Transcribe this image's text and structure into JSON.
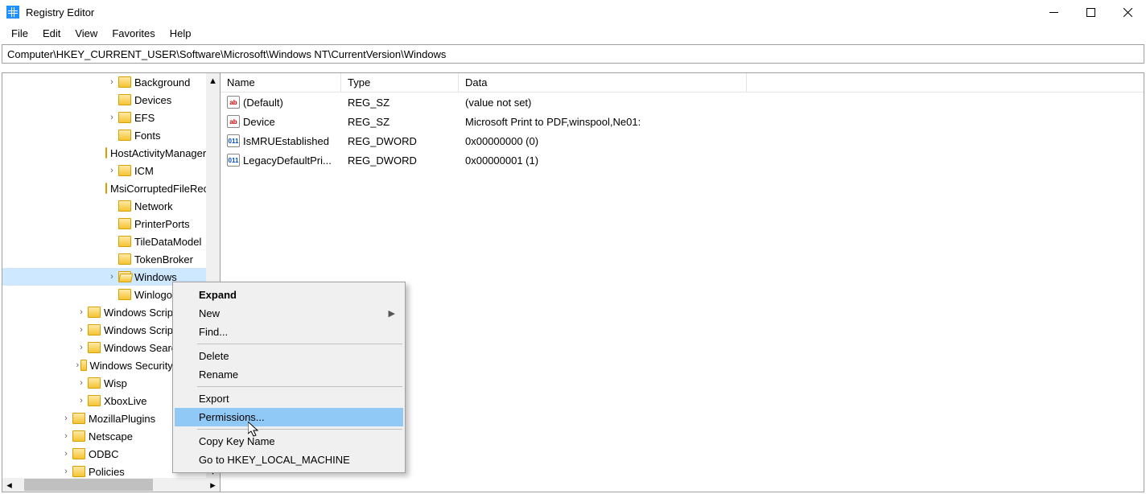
{
  "window": {
    "title": "Registry Editor"
  },
  "menubar": [
    "File",
    "Edit",
    "View",
    "Favorites",
    "Help"
  ],
  "address": "Computer\\HKEY_CURRENT_USER\\Software\\Microsoft\\Windows NT\\CurrentVersion\\Windows",
  "tree": [
    {
      "indent": 128,
      "exp": ">",
      "label": "Background",
      "selected": false
    },
    {
      "indent": 128,
      "exp": "",
      "label": "Devices"
    },
    {
      "indent": 128,
      "exp": ">",
      "label": "EFS"
    },
    {
      "indent": 128,
      "exp": "",
      "label": "Fonts"
    },
    {
      "indent": 128,
      "exp": "",
      "label": "HostActivityManager"
    },
    {
      "indent": 128,
      "exp": ">",
      "label": "ICM"
    },
    {
      "indent": 128,
      "exp": "",
      "label": "MsiCorruptedFileRecovery"
    },
    {
      "indent": 128,
      "exp": "",
      "label": "Network"
    },
    {
      "indent": 128,
      "exp": "",
      "label": "PrinterPorts"
    },
    {
      "indent": 128,
      "exp": "",
      "label": "TileDataModel"
    },
    {
      "indent": 128,
      "exp": "",
      "label": "TokenBroker"
    },
    {
      "indent": 128,
      "exp": ">",
      "label": "Windows",
      "selected": true,
      "open": true
    },
    {
      "indent": 128,
      "exp": "",
      "label": "Winlogon"
    },
    {
      "indent": 90,
      "exp": ">",
      "label": "Windows Script Host"
    },
    {
      "indent": 90,
      "exp": ">",
      "label": "Windows Script Host"
    },
    {
      "indent": 90,
      "exp": ">",
      "label": "Windows Search"
    },
    {
      "indent": 90,
      "exp": ">",
      "label": "Windows Security Health"
    },
    {
      "indent": 90,
      "exp": ">",
      "label": "Wisp"
    },
    {
      "indent": 90,
      "exp": ">",
      "label": "XboxLive"
    },
    {
      "indent": 71,
      "exp": ">",
      "label": "MozillaPlugins"
    },
    {
      "indent": 71,
      "exp": ">",
      "label": "Netscape"
    },
    {
      "indent": 71,
      "exp": ">",
      "label": "ODBC"
    },
    {
      "indent": 71,
      "exp": ">",
      "label": "Policies"
    }
  ],
  "columns": {
    "name": "Name",
    "type": "Type",
    "data": "Data"
  },
  "values": [
    {
      "icon": "str",
      "name": "(Default)",
      "type": "REG_SZ",
      "data": "(value not set)"
    },
    {
      "icon": "str",
      "name": "Device",
      "type": "REG_SZ",
      "data": "Microsoft Print to PDF,winspool,Ne01:"
    },
    {
      "icon": "dw",
      "name": "IsMRUEstablished",
      "type": "REG_DWORD",
      "data": "0x00000000 (0)"
    },
    {
      "icon": "dw",
      "name": "LegacyDefaultPri...",
      "type": "REG_DWORD",
      "data": "0x00000001 (1)"
    }
  ],
  "context_menu": [
    {
      "label": "Expand",
      "bold": true
    },
    {
      "label": "New",
      "submenu": true
    },
    {
      "label": "Find..."
    },
    {
      "sep": true
    },
    {
      "label": "Delete"
    },
    {
      "label": "Rename"
    },
    {
      "sep": true
    },
    {
      "label": "Export"
    },
    {
      "label": "Permissions...",
      "hover": true
    },
    {
      "sep": true
    },
    {
      "label": "Copy Key Name"
    },
    {
      "label": "Go to HKEY_LOCAL_MACHINE"
    }
  ],
  "icon_text": {
    "str": "ab",
    "dw": "011"
  }
}
